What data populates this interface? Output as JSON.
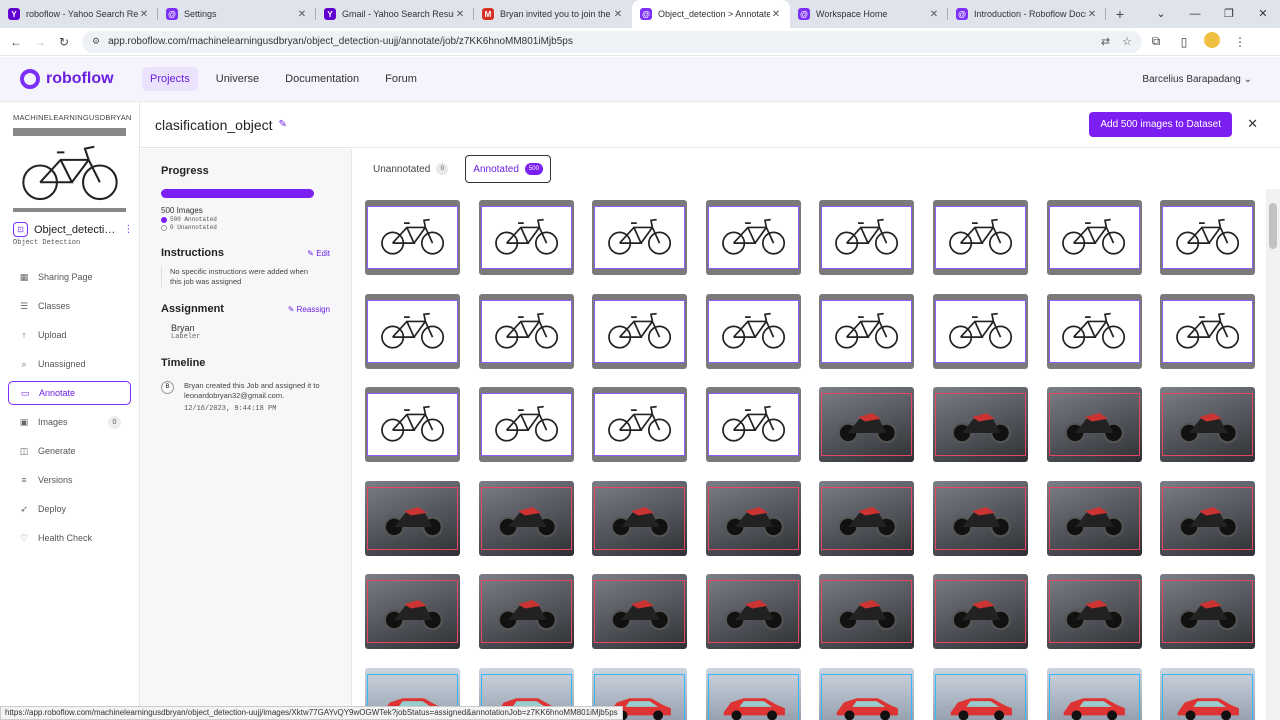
{
  "browser": {
    "tabs": [
      {
        "title": "roboflow - Yahoo Search Result",
        "icon": "yahoo-icon",
        "color": "#6001d2",
        "glyph": "Y"
      },
      {
        "title": "Settings",
        "icon": "roboflow-icon",
        "color": "#7b2ff7",
        "glyph": "@"
      },
      {
        "title": "Gmail - Yahoo Search Results",
        "icon": "yahoo-icon",
        "color": "#6001d2",
        "glyph": "Y"
      },
      {
        "title": "Bryan invited you to join the M",
        "icon": "gmail-icon",
        "color": "#d93025",
        "glyph": "M"
      },
      {
        "title": "Object_detection > Annotate",
        "icon": "roboflow-icon",
        "color": "#7b2ff7",
        "glyph": "@"
      },
      {
        "title": "Workspace Home",
        "icon": "roboflow-icon",
        "color": "#7b2ff7",
        "glyph": "@"
      },
      {
        "title": "Introduction - Roboflow Docs",
        "icon": "roboflow-icon",
        "color": "#7b2ff7",
        "glyph": "@"
      }
    ],
    "active_tab": 4,
    "url": "app.roboflow.com/machinelearningusdbryan/object_detection-uujj/annotate/job/z7KK6hnoMM801iMjb5ps"
  },
  "header": {
    "logo": "roboflow",
    "nav": [
      "Projects",
      "Universe",
      "Documentation",
      "Forum"
    ],
    "active_nav": 0,
    "user": "Barcelius Barapadang"
  },
  "sidebar": {
    "workspace": "MACHINELEARNINGUSDBRYAN",
    "project_name": "Object_detecti…",
    "project_type": "Object Detection",
    "items": [
      {
        "label": "Sharing Page",
        "icon": "grid-icon",
        "glyph": "▦"
      },
      {
        "label": "Classes",
        "icon": "list-icon",
        "glyph": "☰"
      },
      {
        "label": "Upload",
        "icon": "upload-icon",
        "glyph": "↑"
      },
      {
        "label": "Unassigned",
        "icon": "search-icon",
        "glyph": "⌕"
      },
      {
        "label": "Annotate",
        "icon": "annotate-icon",
        "glyph": "▭"
      },
      {
        "label": "Images",
        "icon": "image-icon",
        "glyph": "▣",
        "count": "0"
      },
      {
        "label": "Generate",
        "icon": "generate-icon",
        "glyph": "◫"
      },
      {
        "label": "Versions",
        "icon": "versions-icon",
        "glyph": "≡"
      },
      {
        "label": "Deploy",
        "icon": "deploy-icon",
        "glyph": "➶"
      },
      {
        "label": "Health Check",
        "icon": "health-check-icon",
        "glyph": "♡"
      }
    ],
    "active_item": 4
  },
  "job": {
    "title": "clasification_object",
    "add_button": "Add 500 images to Dataset"
  },
  "details": {
    "progress_heading": "Progress",
    "progress_fraction": 1.0,
    "images_count": "500 Images",
    "annotated_legend": "500 Annotated",
    "unannotated_legend": "0 Unannotated",
    "instructions_heading": "Instructions",
    "edit_label": "Edit",
    "instructions_text": "No specific instructions were added when this job was assigned",
    "assignment_heading": "Assignment",
    "reassign_label": "Reassign",
    "assignee": "Bryan",
    "assignee_role": "Labeler",
    "timeline_heading": "Timeline",
    "timeline_marker": "B",
    "timeline_text": "Bryan created this Job and assigned it to leonardobryan32@gmail.com.",
    "timeline_time": "12/16/2023, 9:44:18 PM"
  },
  "filters": {
    "unannotated_label": "Unannotated",
    "unannotated_count": "0",
    "annotated_label": "Annotated",
    "annotated_count": "500"
  },
  "gallery": {
    "thumbnails": [
      "bike",
      "bike",
      "bike",
      "bike",
      "bike",
      "bike",
      "bike",
      "bike",
      "bike",
      "bike",
      "bike",
      "bike",
      "bike",
      "bike",
      "bike",
      "bike",
      "bike",
      "bike",
      "bike",
      "bike",
      "moto",
      "moto",
      "moto",
      "moto",
      "moto",
      "moto",
      "moto",
      "moto",
      "moto",
      "moto",
      "moto",
      "moto",
      "moto",
      "moto",
      "moto",
      "moto",
      "moto",
      "moto",
      "moto",
      "moto",
      "car",
      "car",
      "car",
      "car",
      "car",
      "car",
      "car",
      "car"
    ]
  },
  "status_url": "https://app.roboflow.com/machinelearningusdbryan/object_detection-uujj/images/Xktw77GAYvQY9wOGWTek?jobStatus=assigned&annotationJob=z7KK6hnoMM801iMjb5ps"
}
